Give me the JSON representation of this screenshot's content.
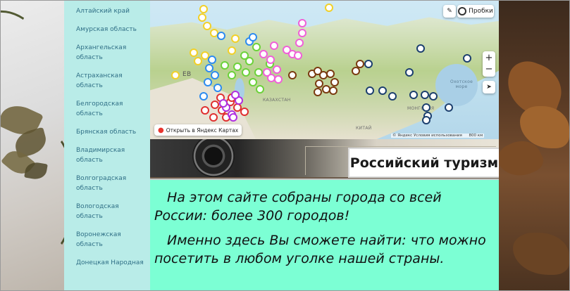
{
  "sidebar": {
    "items": [
      "Алтайский край",
      "Амурская область",
      "Архангельская область",
      "Астраханская область",
      "Белгородская область",
      "Брянская область",
      "Владимирская область",
      "Волгоградская область",
      "Вологодская область",
      "Воронежская область",
      "Донецкая Народная"
    ]
  },
  "map": {
    "traffic_label": "Пробки",
    "zoom_in": "+",
    "zoom_out": "−",
    "open_label": "Открыть в Яндекс Картах",
    "copyright": "© Яндекс   Условия использования",
    "scale": "800 км",
    "labels": {
      "kazakhstan": "КАЗАХСТАН",
      "china": "КИТАЙ",
      "mongolia": "МОНГОЛИЯ",
      "ev": "ЕВ",
      "okhotsk": "Охотское море"
    },
    "marker_colors": {
      "yellow": "#f2d028",
      "blue": "#2d8bf0",
      "green": "#6cd23a",
      "pink": "#f060d8",
      "red": "#e03030",
      "purple": "#b030e0",
      "brown": "#7a3a10",
      "navy": "#1c3f6e"
    }
  },
  "title": "Российский туризм",
  "content": {
    "p1": "На этом сайте собраны города со всей России: более 300 городов!",
    "p2": "Именно здесь Вы сможете найти: что можно посетить в любом уголке нашей страны."
  }
}
